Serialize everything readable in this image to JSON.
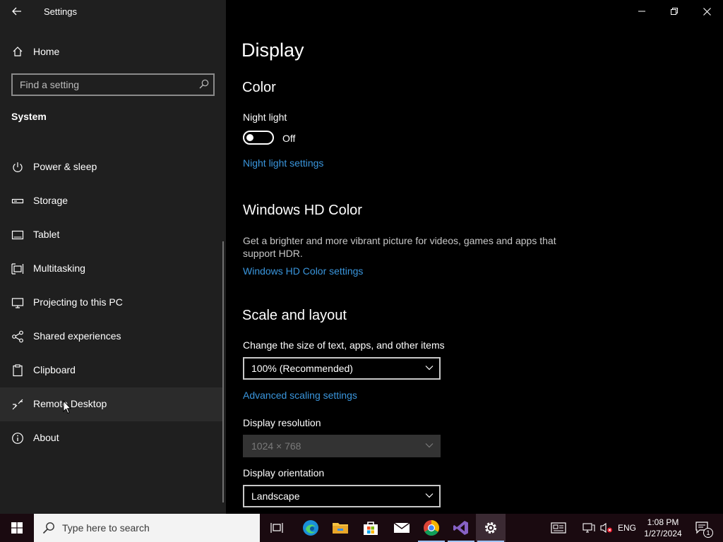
{
  "window": {
    "title": "Settings",
    "controls": {
      "minimize": "minimize",
      "restore": "restore",
      "close": "close"
    }
  },
  "sidebar": {
    "home_label": "Home",
    "search_placeholder": "Find a setting",
    "section_heading": "System",
    "items": [
      {
        "label": "Power & sleep",
        "icon": "power-icon"
      },
      {
        "label": "Storage",
        "icon": "storage-icon"
      },
      {
        "label": "Tablet",
        "icon": "tablet-icon"
      },
      {
        "label": "Multitasking",
        "icon": "multitasking-icon"
      },
      {
        "label": "Projecting to this PC",
        "icon": "projecting-icon"
      },
      {
        "label": "Shared experiences",
        "icon": "shared-icon"
      },
      {
        "label": "Clipboard",
        "icon": "clipboard-icon"
      },
      {
        "label": "Remote Desktop",
        "icon": "remote-desktop-icon",
        "hovered": true
      },
      {
        "label": "About",
        "icon": "info-icon"
      }
    ]
  },
  "main": {
    "title": "Display",
    "color": {
      "heading": "Color",
      "night_light_label": "Night light",
      "night_light_state": "Off",
      "night_light_settings_link": "Night light settings"
    },
    "hdr": {
      "heading": "Windows HD Color",
      "description": "Get a brighter and more vibrant picture for videos, games and apps that support HDR.",
      "link": "Windows HD Color settings"
    },
    "scale": {
      "heading": "Scale and layout",
      "size_label": "Change the size of text, apps, and other items",
      "size_value": "100% (Recommended)",
      "advanced_link": "Advanced scaling settings",
      "resolution_label": "Display resolution",
      "resolution_value": "1024 × 768",
      "orientation_label": "Display orientation",
      "orientation_value": "Landscape"
    }
  },
  "taskbar": {
    "search_placeholder": "Type here to search",
    "language": "ENG",
    "time": "1:08 PM",
    "date": "1/27/2024",
    "notification_count": "1"
  },
  "colors": {
    "accent_link": "#3a96dd",
    "sidebar_bg": "#1f1f1f",
    "main_bg": "#000000",
    "taskbar_bg": "#1a0a10"
  }
}
